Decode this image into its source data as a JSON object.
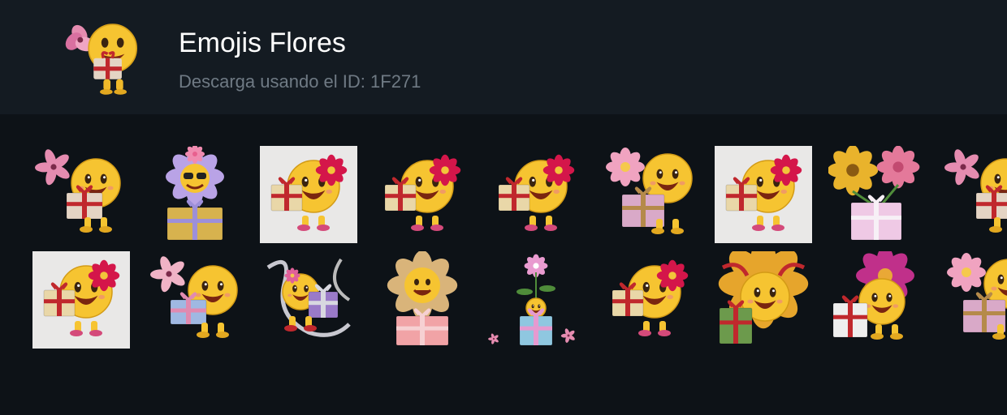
{
  "header": {
    "title": "Emojis Flores",
    "subtitle": "Descarga usando el ID: 1F271"
  },
  "colors": {
    "page_bg": "#0d1217",
    "header_bg": "#141b22",
    "title": "#ffffff",
    "subtitle": "#6f7a84",
    "emoji_yellow": "#f6c431",
    "flower_pink": "#e86aa0",
    "flower_red": "#d4164a",
    "gift_gold": "#d7b24e",
    "gift_pink": "#e9a6b8",
    "gift_blue": "#8fc7e0",
    "ribbon_red": "#c0282d"
  },
  "stickers": [
    {
      "icon": "emoji-pink-lily-gift-sticker",
      "bg": "dark"
    },
    {
      "icon": "emoji-sunglasses-lavender-flower-gift-sticker",
      "bg": "dark"
    },
    {
      "icon": "emoji-red-flower-gift-sticker",
      "bg": "light"
    },
    {
      "icon": "emoji-red-flower-gift-sticker",
      "bg": "dark"
    },
    {
      "icon": "emoji-red-flower-gift-sticker",
      "bg": "dark"
    },
    {
      "icon": "emoji-pink-flower-gift-sticker",
      "bg": "dark"
    },
    {
      "icon": "emoji-red-flower-gift-sticker",
      "bg": "light"
    },
    {
      "icon": "sunflower-carnation-gift-sticker",
      "bg": "dark"
    },
    {
      "icon": "emoji-pink-lily-gift-sticker",
      "bg": "dark"
    },
    {
      "icon": "emoji-red-flower-gift-sticker",
      "bg": "light"
    },
    {
      "icon": "emoji-lily-bouquet-gift-sticker",
      "bg": "dark"
    },
    {
      "icon": "emoji-ribbons-gift-sticker",
      "bg": "dark"
    },
    {
      "icon": "fluffy-flower-emoji-gift-sticker",
      "bg": "dark"
    },
    {
      "icon": "small-emoji-flower-gift-sticker",
      "bg": "dark"
    },
    {
      "icon": "emoji-red-flower-gift-sticker",
      "bg": "dark"
    },
    {
      "icon": "emoji-sunflower-ribbon-gift-sticker",
      "bg": "dark"
    },
    {
      "icon": "emoji-dahlia-gift-sticker",
      "bg": "dark"
    },
    {
      "icon": "emoji-pink-flower-gift-sticker",
      "bg": "dark"
    }
  ]
}
